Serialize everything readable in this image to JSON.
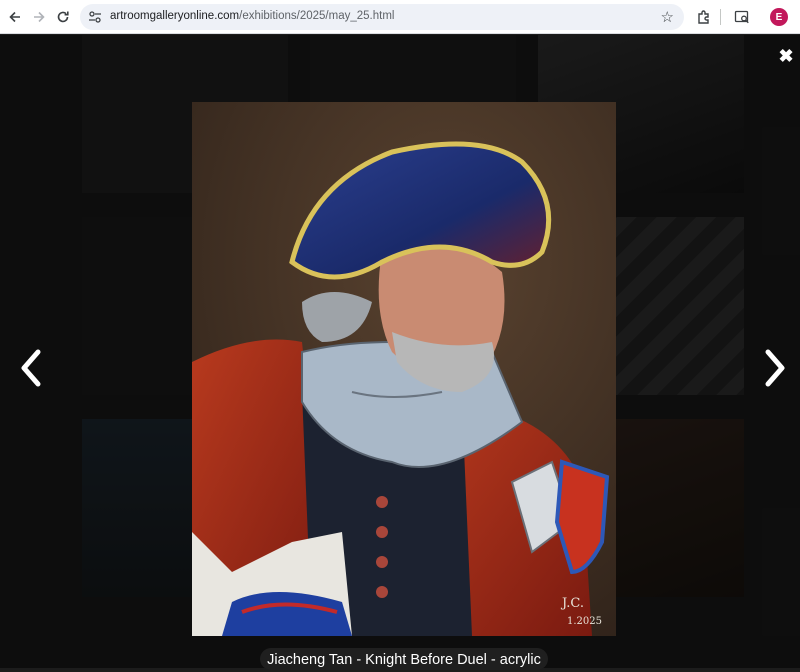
{
  "browser": {
    "url_host": "artroomgalleryonline.com",
    "url_path": "/exhibitions/2025/may_25.html",
    "profile_initial": "E"
  },
  "lightbox": {
    "caption": "Jiacheng Tan - Knight Before Duel - acrylic",
    "signature_line1": "J.C.",
    "signature_line2": "1.2025"
  },
  "icons": [
    "back-arrow-icon",
    "forward-arrow-icon",
    "reload-icon",
    "site-settings-icon",
    "star-icon",
    "extensions-icon",
    "search-tab-icon",
    "close-icon",
    "chevron-left-icon",
    "chevron-right-icon"
  ]
}
